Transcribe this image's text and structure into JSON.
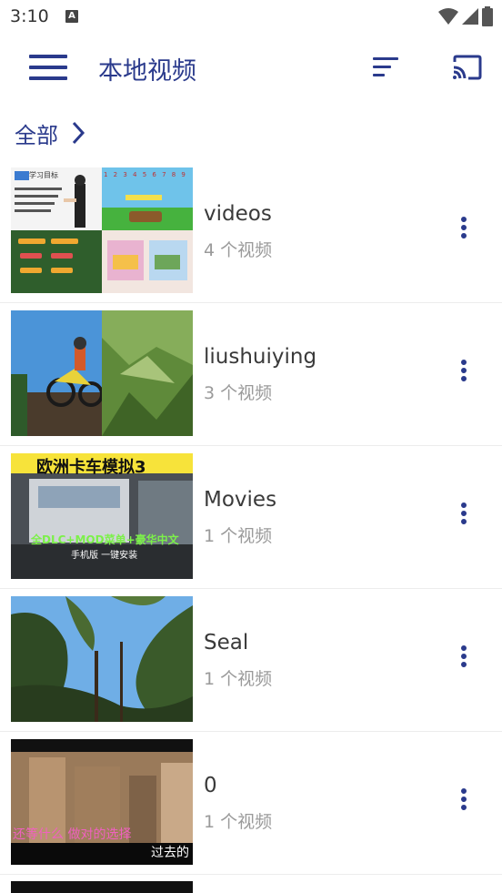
{
  "status_bar": {
    "time": "3:10",
    "notification_badge": "A"
  },
  "app_bar": {
    "title": "本地视频",
    "menu_icon": "menu-icon",
    "sort_icon": "sort-icon",
    "cast_icon": "cast-icon"
  },
  "breadcrumb": {
    "label": "全部",
    "chevron_icon": "chevron-right-icon"
  },
  "colors": {
    "accent": "#2a3a8c",
    "name_text": "#3a3a3a",
    "count_text": "#9a9a9a"
  },
  "folders": [
    {
      "name": "videos",
      "count": "4 个视频"
    },
    {
      "name": "liushuiying",
      "count": "3 个视频"
    },
    {
      "name": "Movies",
      "count": "1 个视频"
    },
    {
      "name": "Seal",
      "count": "1 个视频"
    },
    {
      "name": "0",
      "count": "1 个视频"
    }
  ],
  "thumbnails": {
    "videos": {
      "title_text": "学习目标",
      "row_numbers": "1 2 3 4 5 6 7 8 9"
    },
    "movies": {
      "banner": "欧洲卡车模拟3",
      "line1": "全DLC+MOD菜单+豪华中文",
      "line2": "手机版 一键安装"
    },
    "folder_0": {
      "subtitle_left": "还等什么  做对的选择",
      "subtitle_right": "过去的"
    }
  }
}
